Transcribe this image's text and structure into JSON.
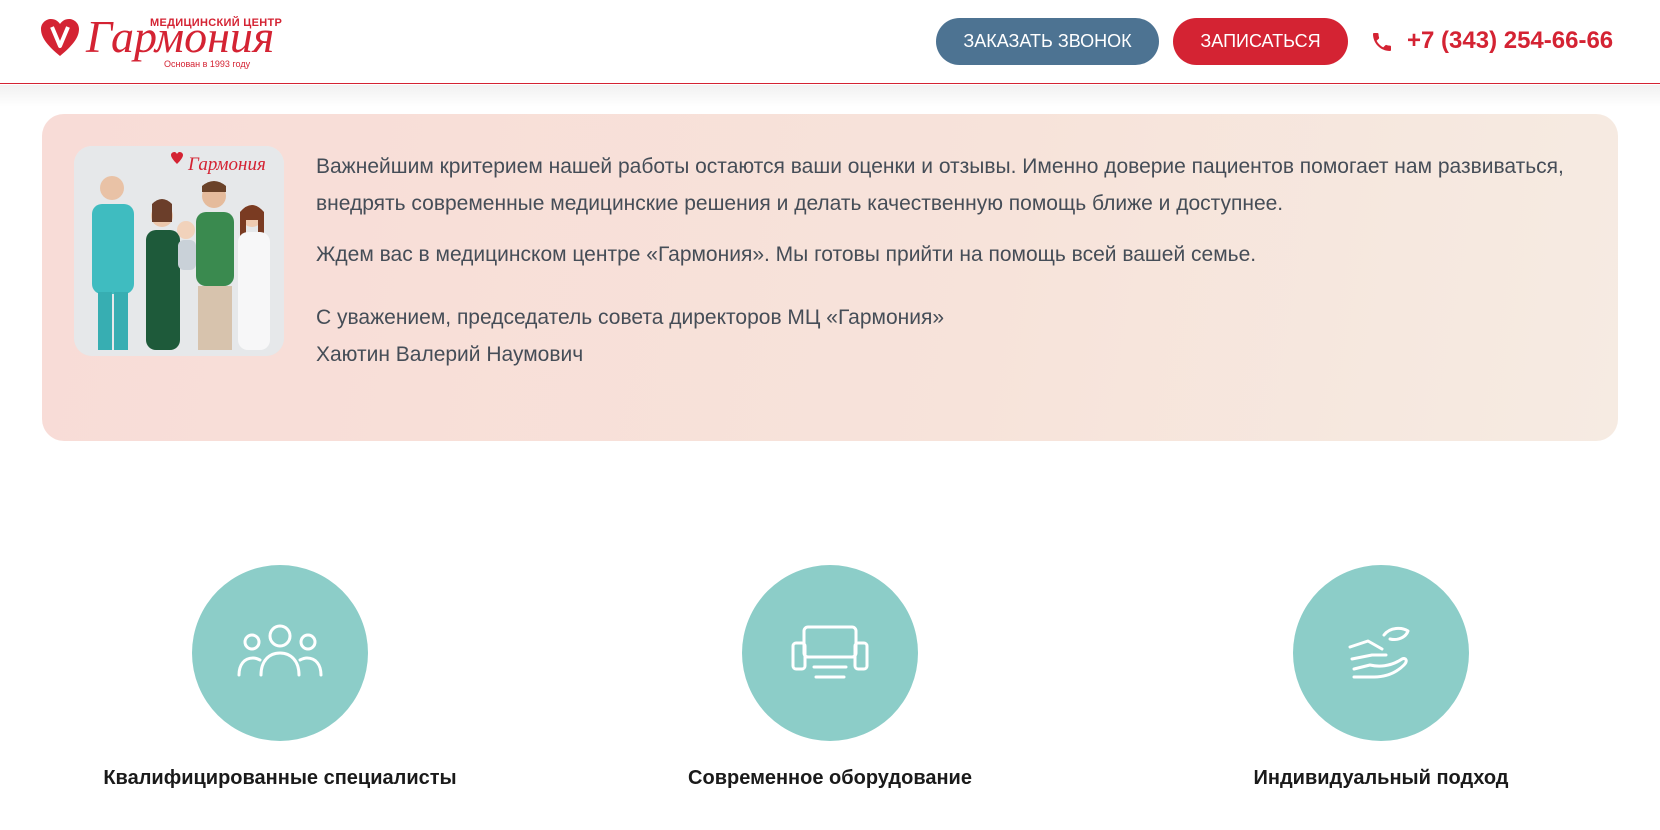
{
  "header": {
    "logo": {
      "top_text": "МЕДИЦИНСКИЙ ЦЕНТР",
      "name": "Гармония",
      "sub_text": "Основан в 1993 году"
    },
    "call_button": "ЗАКАЗАТЬ ЗВОНОК",
    "signup_button": "ЗАПИСАТЬСЯ",
    "phone_icon": "phone-icon",
    "phone": "+7 (343) 254-66-66"
  },
  "message": {
    "photo_logo_name": "Гармония",
    "paragraphs": [
      "Важнейшим критерием нашей работы остаются ваши оценки и отзывы. Именно доверие пациентов помогает нам развиваться, внедрять современные медицинские решения и делать качественную помощь ближе и доступнее.",
      "Ждем вас в медицинском центре «Гармония». Мы готовы прийти на помощь всей вашей семье."
    ],
    "signature_line1": "С уважением, председатель совета директоров МЦ «Гармония»",
    "signature_line2": "Хаютин Валерий Наумович"
  },
  "features": [
    {
      "icon": "people-icon",
      "label": "Квалифицированные специалисты"
    },
    {
      "icon": "equipment-icon",
      "label": "Современное оборудование"
    },
    {
      "icon": "hand-care-icon",
      "label": "Индивидуальный подход"
    }
  ],
  "colors": {
    "brand_red": "#d42333",
    "button_blue": "#4d7392",
    "teal": "#8ccdc8"
  }
}
